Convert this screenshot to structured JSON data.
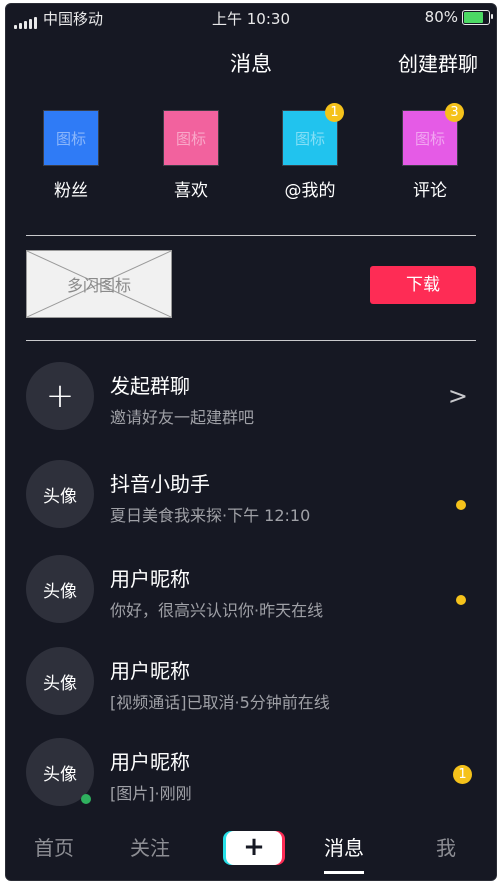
{
  "status_bar": {
    "carrier": "中国移动",
    "time": "上午 10:30",
    "battery": "80%",
    "battery_level": 0.8
  },
  "header": {
    "title": "消息",
    "action": "创建群聊"
  },
  "quick_actions": [
    {
      "icon_text": "图标",
      "label": "粉丝",
      "color": "#2f7bf6",
      "badge": ""
    },
    {
      "icon_text": "图标",
      "label": "喜欢",
      "color": "#f2629e",
      "badge": ""
    },
    {
      "icon_text": "图标",
      "label": "@我的",
      "color": "#21c3ee",
      "badge": "1"
    },
    {
      "icon_text": "图标",
      "label": "评论",
      "color": "#e55be6",
      "badge": "3"
    }
  ],
  "banner": {
    "placeholder": "多闪图标",
    "download_label": "下载"
  },
  "conversations": [
    {
      "avatar": "+",
      "name": "发起群聊",
      "subtitle": "邀请好友一起建群吧",
      "indicator": ">"
    },
    {
      "avatar": "头像",
      "name": "抖音小助手",
      "subtitle": "夏日美食我来探·下午 12:10",
      "indicator": ""
    },
    {
      "avatar": "头像",
      "name": "用户昵称",
      "subtitle": "你好，很高兴认识你·昨天在线",
      "indicator": ""
    },
    {
      "avatar": "头像",
      "name": "用户昵称",
      "subtitle": "[视频通话]已取消·5分钟前在线",
      "indicator": ""
    },
    {
      "avatar": "头像",
      "name": "用户昵称",
      "subtitle": "[图片]·刚刚",
      "indicator": "1"
    }
  ],
  "tab_bar": {
    "home": "首页",
    "follow": "关注",
    "plus": "+",
    "messages": "消息",
    "me": "我"
  },
  "colors": {
    "background": "#161823",
    "accent": "#fe2c55",
    "badge": "#f5c21b",
    "online": "#2fb15f"
  }
}
